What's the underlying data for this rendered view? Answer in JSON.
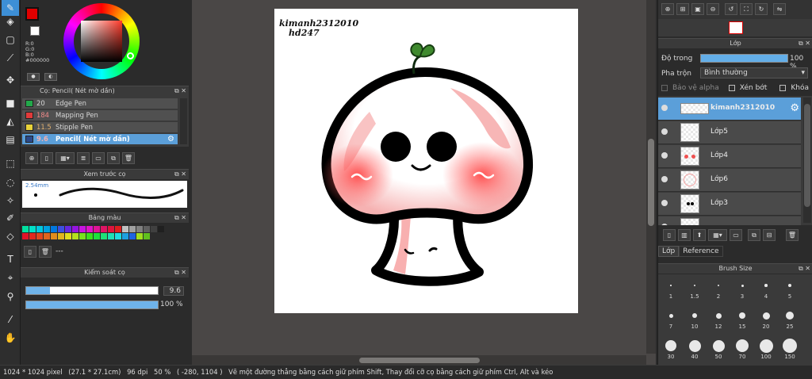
{
  "colors": {
    "accent": "#5b9fd9",
    "foreground_color": "#e00000",
    "layer_opacity_bar": "#63aee8"
  },
  "color_picker": {
    "r": "R:0",
    "g": "G:0",
    "b": "B:0",
    "hex": "#000000"
  },
  "brush_panel": {
    "title": "Cọ: Pencil( Nét mờ dần)",
    "pens": [
      {
        "size": "20",
        "name": "Edge Pen",
        "color": "#22a84a"
      },
      {
        "size": "184",
        "name": "Mapping Pen",
        "color": "#e03a3a"
      },
      {
        "size": "11.5",
        "name": "Stipple Pen",
        "color": "#e8d23a"
      },
      {
        "size": "9.6",
        "name": "Pencil( Nét mờ dần)",
        "color": "#2b4a8a"
      }
    ]
  },
  "preview_panel": {
    "title": "Xem trước cọ",
    "size_label": "2.54mm"
  },
  "palette_panel": {
    "title": "Bảng màu",
    "value": "---",
    "row1": [
      "#00e0a0",
      "#00e0c8",
      "#00c8e0",
      "#00a0e0",
      "#0078e0",
      "#3c50e0",
      "#6428e0",
      "#9614e0",
      "#c814e0",
      "#e014c8",
      "#e01496",
      "#e01464",
      "#e0143c",
      "#e01e1e",
      "#c0c0c0",
      "#a0a0a0",
      "#808080",
      "#606060",
      "#404040",
      "#202020"
    ],
    "row2": [
      "#e01428",
      "#e0281e",
      "#e0461e",
      "#e0641e",
      "#e08c1e",
      "#e0b41e",
      "#e0dc1e",
      "#b4e01e",
      "#78e01e",
      "#3ce01e",
      "#1ee03c",
      "#1ee078",
      "#1ee0b4",
      "#1edce0",
      "#1ea0e0",
      "#1e64e0",
      "#a0e01e",
      "#60c01e"
    ]
  },
  "brush_control": {
    "title": "Kiểm soát cọ",
    "size_value": "9.6",
    "size_fraction": 0.18,
    "opacity_value": "100 %",
    "opacity_fraction": 1.0
  },
  "canvas": {
    "text_line1": "kimanh2312010",
    "text_line2": "hd247"
  },
  "layer_panel": {
    "title": "Lớp",
    "opacity_label": "Độ trong",
    "opacity_value": "100 %",
    "opacity_fraction": 1.0,
    "blend_label": "Pha trộn",
    "blend_value": "Bình thường",
    "protect_alpha": "Bảo vệ alpha",
    "clipping": "Xén bớt",
    "lock": "Khóa",
    "layers": [
      {
        "name": "kimanh2312010",
        "selected": true
      },
      {
        "name": "Lớp5",
        "selected": false
      },
      {
        "name": "Lớp4",
        "selected": false
      },
      {
        "name": "Lớp6",
        "selected": false
      },
      {
        "name": "Lớp3",
        "selected": false
      }
    ],
    "tabs": [
      "Lớp",
      "Reference"
    ]
  },
  "brush_size_panel": {
    "title": "Brush Size",
    "sizes": [
      "1",
      "1.5",
      "2",
      "3",
      "4",
      "5",
      "7",
      "10",
      "12",
      "15",
      "20",
      "25",
      "30",
      "40",
      "50",
      "70",
      "100",
      "150"
    ]
  },
  "status_bar": {
    "dimensions": "1024 * 1024 pixel",
    "physical": "(27.1 * 27.1cm)",
    "dpi": "96 dpi",
    "zoom": "50 %",
    "coords": "( -280, 1104 )",
    "hint": "Vẽ một đường thẳng bằng cách giữ phím Shift, Thay đổi cỡ cọ bằng cách giữ phím Ctrl, Alt và kéo"
  }
}
